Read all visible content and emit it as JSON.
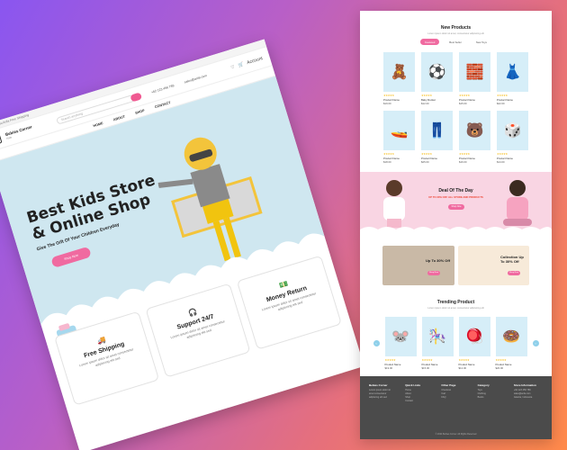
{
  "left": {
    "topbar_text": "Welcome to Anfa Free Shipping",
    "brand": "Bebies Corner",
    "brand_sub": "Kids",
    "search_placeholder": "Search anything",
    "phone": "+62 123 456 789",
    "email": "sales@anfa.com",
    "account": "Account",
    "nav": [
      "HOME",
      "ABOUT",
      "SHOP",
      "CONTACT"
    ],
    "hero_title_1": "Best Kids Store",
    "hero_title_2": "& Online Shop",
    "hero_sub": "Give The Gift Of Your Children Everyday",
    "hero_btn": "Shop Now",
    "features": [
      {
        "icon": "🚚",
        "title": "Free Shipping",
        "desc": "Lorem ipsum dolor sit amet consectetur adipiscing elit sed"
      },
      {
        "icon": "🎧",
        "title": "Support 24/7",
        "desc": "Lorem ipsum dolor sit amet consectetur adipiscing elit sed"
      },
      {
        "icon": "💵",
        "title": "Money Return",
        "desc": "Lorem ipsum dolor sit amet consectetur adipiscing elit sed"
      }
    ]
  },
  "right": {
    "new_title": "New Products",
    "new_desc": "Lorem ipsum dolor sit amet, consectetur adipiscing elit",
    "tabs": [
      "Featured",
      "Best Seller",
      "New Toys"
    ],
    "products": [
      {
        "icon": "🧸",
        "name": "Product Name",
        "price": "$19.00"
      },
      {
        "icon": "⚽",
        "name": "Baby Rocket",
        "price": "$12.00"
      },
      {
        "icon": "🧱",
        "name": "Product Name",
        "price": "$15.00"
      },
      {
        "icon": "👗",
        "name": "Product Name",
        "price": "$22.00"
      },
      {
        "icon": "🚤",
        "name": "Product Name",
        "price": "$18.00"
      },
      {
        "icon": "👖",
        "name": "Product Name",
        "price": "$25.00"
      },
      {
        "icon": "🐻",
        "name": "Product Name",
        "price": "$16.00"
      },
      {
        "icon": "🎲",
        "name": "Product Name",
        "price": "$14.00"
      }
    ],
    "deal_title": "Deal Of The Day",
    "deal_sub": "UP TO 30% OFF ALL STORE AND PRODUCTS",
    "deal_btn": "Shop Now",
    "banner1_text": "Up To 30% Off",
    "banner2_text": "Collection Up To 30% Off",
    "banner_btn": "Shop Now",
    "trend_title": "Trending Product",
    "trend_desc": "Lorem ipsum dolor sit amet, consectetur adipiscing elit",
    "trending": [
      {
        "icon": "🐭",
        "name": "Product Name",
        "price": "$19.00"
      },
      {
        "icon": "🎠",
        "name": "Product Name",
        "price": "$15.00"
      },
      {
        "icon": "🪀",
        "name": "Product Name",
        "price": "$12.00"
      },
      {
        "icon": "🍩",
        "name": "Product Name",
        "price": "$20.00"
      }
    ],
    "footer_cols": [
      {
        "title": "Bebies Corner",
        "lines": [
          "Lorem ipsum dolor sit",
          "amet consectetur",
          "adipiscing elit sed"
        ]
      },
      {
        "title": "Quick Links",
        "lines": [
          "Home",
          "About",
          "Shop",
          "Contact"
        ]
      },
      {
        "title": "Other Page",
        "lines": [
          "Checkout",
          "Cart",
          "FAQ"
        ]
      },
      {
        "title": "Category",
        "lines": [
          "Toys",
          "Clothing",
          "Books"
        ]
      },
      {
        "title": "Store Information",
        "lines": [
          "+62 123 456 789",
          "sales@anfa.com",
          "Jakarta, Indonesia"
        ]
      }
    ],
    "copyright": "© 2024 Bebies Corner. All Rights Reserved"
  }
}
